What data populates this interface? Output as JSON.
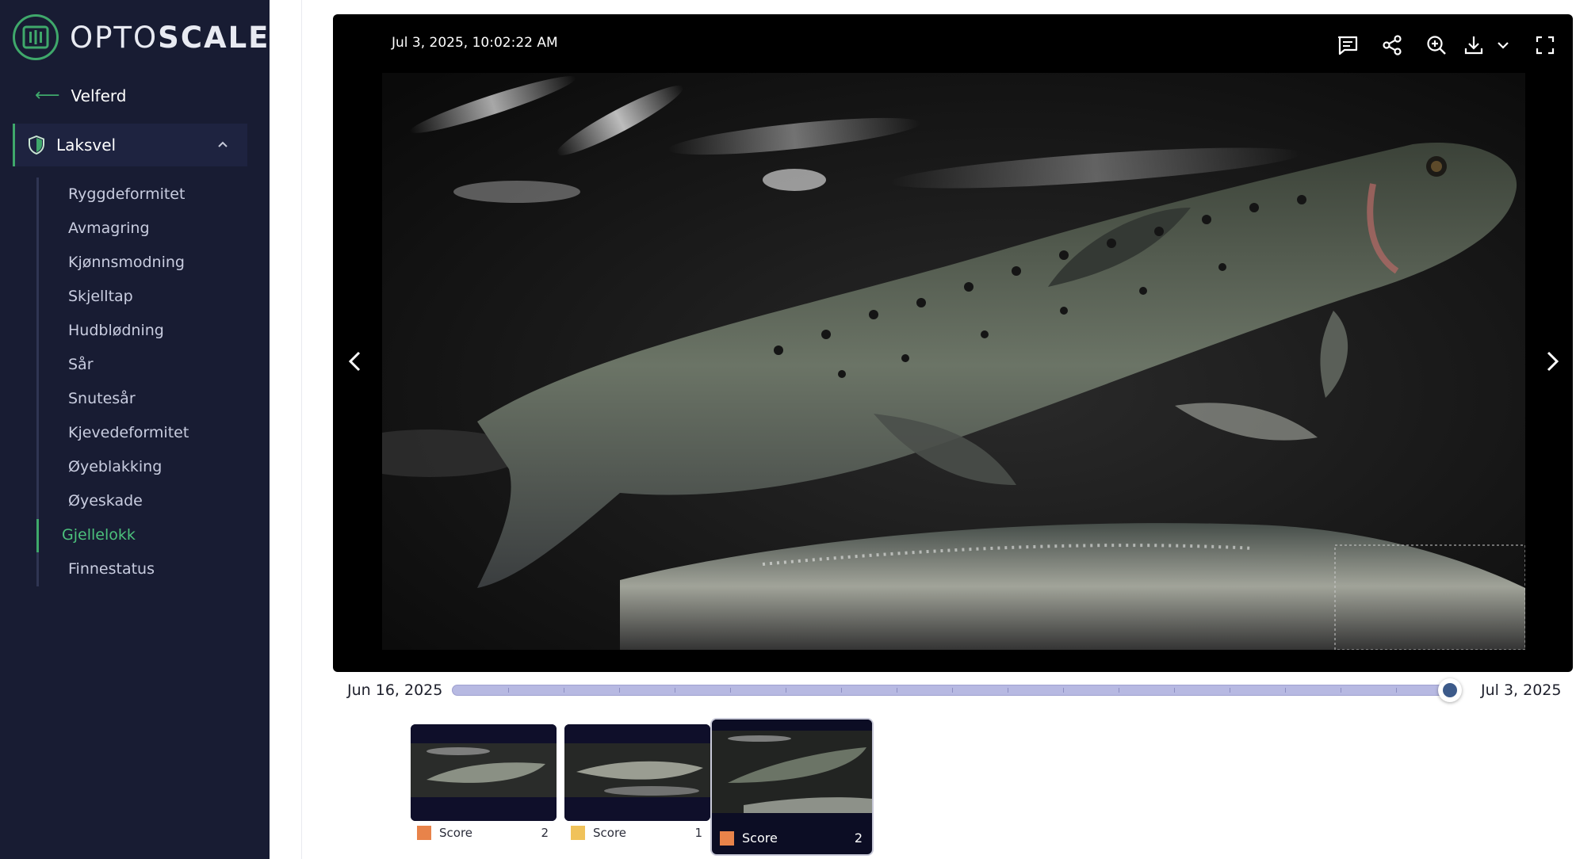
{
  "app": {
    "logo_text_light": "OPTO",
    "logo_text_bold": "SCALE",
    "brand_color": "#3fa86b"
  },
  "sidebar": {
    "back_label": "Velferd",
    "group_label": "Laksvel",
    "items": [
      {
        "label": "Ryggdeformitet"
      },
      {
        "label": "Avmagring"
      },
      {
        "label": "Kjønnsmodning"
      },
      {
        "label": "Skjelltap"
      },
      {
        "label": "Hudblødning"
      },
      {
        "label": "Sår"
      },
      {
        "label": "Snutesår"
      },
      {
        "label": "Kjevedeformitet"
      },
      {
        "label": "Øyeblakking"
      },
      {
        "label": "Øyeskade"
      },
      {
        "label": "Gjellelokk",
        "active": true
      },
      {
        "label": "Finnestatus"
      }
    ]
  },
  "viewer": {
    "timestamp": "Jul 3, 2025, 10:02:22 AM",
    "toolbar": [
      "comment-icon",
      "share-icon",
      "zoom-in-icon",
      "download-icon",
      "chevron-down-icon",
      "fullscreen-icon"
    ]
  },
  "timeline": {
    "start": "Jun 16, 2025",
    "end": "Jul 3, 2025",
    "position": 1.0
  },
  "thumbnails": [
    {
      "label": "Score",
      "score": "2",
      "color": "#e8834a"
    },
    {
      "label": "Score",
      "score": "1",
      "color": "#f0c25a"
    },
    {
      "label": "Score",
      "score": "2",
      "color": "#e8834a",
      "selected": true
    }
  ]
}
